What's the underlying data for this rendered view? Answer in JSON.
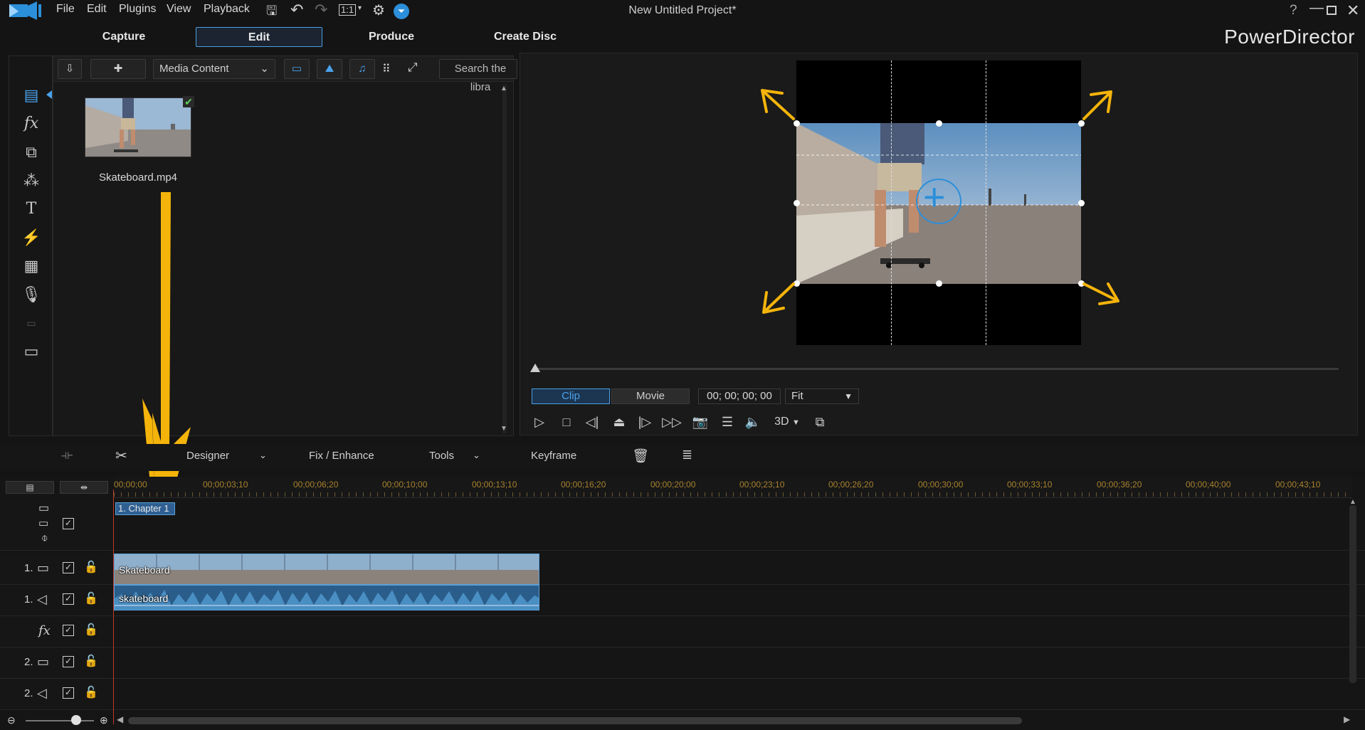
{
  "menubar": {
    "items": [
      "File",
      "Edit",
      "Plugins",
      "View",
      "Playback"
    ],
    "ratio_label": "1:1",
    "window_title": "New Untitled Project*",
    "help": "?"
  },
  "top_tabs": [
    "Capture",
    "Edit",
    "Produce",
    "Create Disc"
  ],
  "brand": "PowerDirector",
  "library": {
    "media_select": "Media Content",
    "search_placeholder": "Search the libra",
    "item_label": "Skateboard.mp4"
  },
  "preview": {
    "mode_clip": "Clip",
    "mode_movie": "Movie",
    "timecode": "00; 00; 00; 00",
    "fit": "Fit",
    "stereo": "3D"
  },
  "edit_toolbar": {
    "designer": "Designer",
    "fix_enhance": "Fix / Enhance",
    "tools": "Tools",
    "keyframe": "Keyframe"
  },
  "timeline": {
    "ticks": [
      "00;00;00",
      "00;00;03;10",
      "00;00;06;20",
      "00;00;10;00",
      "00;00;13;10",
      "00;00;16;20",
      "00;00;20;00",
      "00;00;23;10",
      "00;00;26;20",
      "00;00;30;00",
      "00;00;33;10",
      "00;00;36;20",
      "00;00;40;00",
      "00;00;43;10"
    ],
    "chapter": "1. Chapter 1",
    "video_clip": "Skateboard",
    "audio_clip": "skateboard",
    "track_nums": {
      "v1": "1.",
      "a1": "1.",
      "v2": "2.",
      "a2": "2."
    }
  },
  "colors": {
    "accent": "#4a9fe6",
    "arrow": "#f5b40a",
    "clip": "#2f6ea6"
  }
}
